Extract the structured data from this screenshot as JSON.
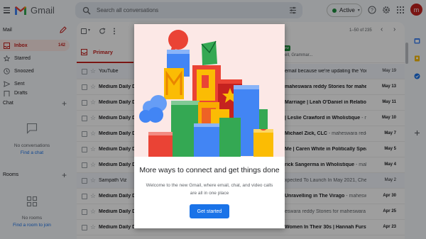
{
  "app": {
    "name": "Gmail"
  },
  "search": {
    "placeholder": "Search all conversations"
  },
  "status": {
    "label": "Active"
  },
  "account": {
    "initial": "m"
  },
  "colors": {
    "accent": "#c5221f",
    "primary_button": "#1a73e8",
    "active_dot": "#1e8e3e"
  },
  "sidebar": {
    "mail_label": "Mail",
    "items": [
      {
        "label": "Inbox",
        "count": "142",
        "icon": "inbox-icon"
      },
      {
        "label": "Starred",
        "icon": "star-icon"
      },
      {
        "label": "Snoozed",
        "icon": "clock-icon"
      },
      {
        "label": "Sent",
        "icon": "send-icon"
      },
      {
        "label": "Drafts",
        "icon": "draft-icon"
      }
    ],
    "chat": {
      "title": "Chat",
      "empty": "No conversations",
      "link": "Find a chat"
    },
    "rooms": {
      "title": "Rooms",
      "empty": "No rooms",
      "link": "Find a room to join"
    }
  },
  "toolbar": {
    "pager": "1–50 of 235"
  },
  "tabs": {
    "primary": "Primary",
    "other_badge": "New",
    "other_sub": "ssell, Grammar..."
  },
  "emails": [
    {
      "sender": "YouTube",
      "snippet_bold": "email because we're updating the You",
      "snippet": "",
      "date": "May 19",
      "read": true
    },
    {
      "sender": "Medium Daily Digest",
      "snippet_bold": "maheswara reddy Stories for maheswara",
      "snippet": "",
      "date": "May 13",
      "read": false
    },
    {
      "sender": "Medium Daily Digest",
      "snippet_bold": "Marriage | Leah O'Daniel in Relationsh",
      "snippet": "",
      "date": "May 11",
      "read": false
    },
    {
      "sender": "Medium Daily Digest",
      "snippet_bold": "| Leslie Crawford in Wholistique",
      "snippet": " - mah",
      "date": "May 10",
      "read": false
    },
    {
      "sender": "Medium Daily Digest",
      "snippet_bold": "Michael Zick, CLC",
      "snippet": " - maheswara reddy St",
      "date": "May 7",
      "read": false
    },
    {
      "sender": "Medium Daily Digest",
      "snippet_bold": "Me | Caren White in Politically Speaking",
      "snippet": " - m",
      "date": "May 5",
      "read": false
    },
    {
      "sender": "Medium Daily Digest",
      "snippet_bold": "rick Sangerma in Wholistique",
      "snippet": " - maheswa",
      "date": "May 4",
      "read": false
    },
    {
      "sender": "Sampath Viz",
      "snippet_bold": "",
      "snippet": "xpected To Launch In May 2021, Check",
      "date": "May 2",
      "read": true
    },
    {
      "sender": "Medium Daily Digest",
      "snippet_bold": "Unravelling in The Virago",
      "snippet": " - maheswara r",
      "date": "Apr 30",
      "read": false
    },
    {
      "sender": "Medium Daily Digest",
      "snippet_bold": "",
      "snippet": "eswara reddy Stories for maheswara redd",
      "date": "Apr 25",
      "read": false
    },
    {
      "sender": "Medium Daily Digest",
      "snippet_bold": "Women In Their 30s | Hannah Furst in Slackjaw",
      "snippet": "",
      "date": "Apr 23",
      "read": false
    }
  ],
  "modal": {
    "title": "More ways to connect and get things done",
    "subtitle": "Welcome to the new Gmail, where email, chat, and video calls are all in one place",
    "button": "Get started"
  }
}
